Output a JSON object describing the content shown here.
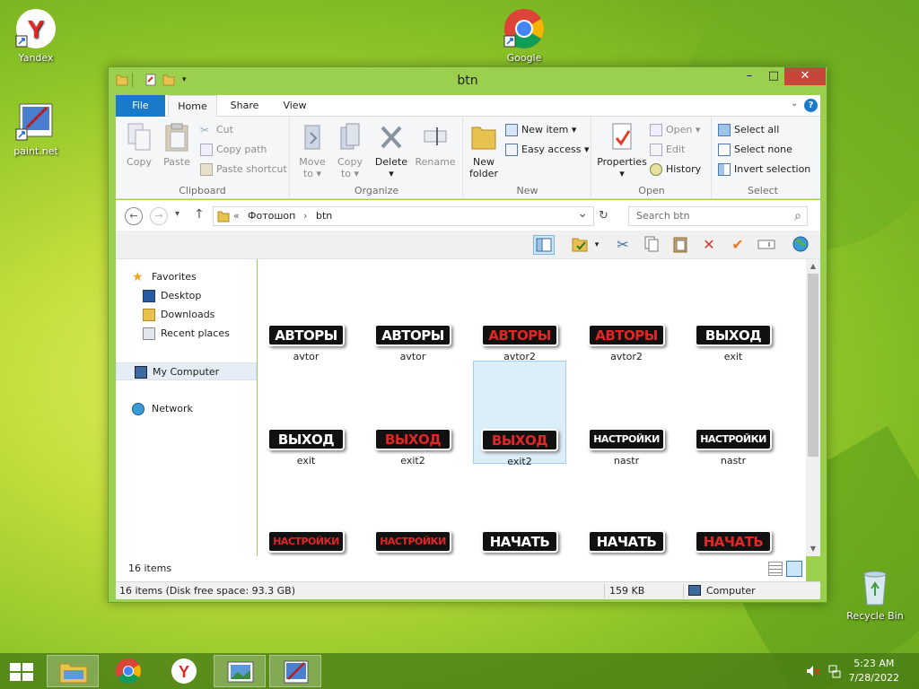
{
  "desktop": {
    "icons": [
      {
        "label": "Yandex"
      },
      {
        "label": "Google"
      },
      {
        "label": "paint.net"
      },
      {
        "label": "Recycle Bin"
      }
    ]
  },
  "window": {
    "title": "btn",
    "controls": {
      "minimize": "–",
      "maximize": "□",
      "close": "✕"
    }
  },
  "ribbon": {
    "tabs": [
      "File",
      "Home",
      "Share",
      "View"
    ],
    "clipboard": {
      "label": "Clipboard",
      "copy": "Copy",
      "paste": "Paste",
      "cut": "Cut",
      "copy_path": "Copy path",
      "paste_shortcut": "Paste shortcut"
    },
    "organize": {
      "label": "Organize",
      "move_to": "Move",
      "move_to2": "to ▾",
      "copy_to": "Copy",
      "copy_to2": "to ▾",
      "delete": "Delete",
      "delete2": "▾",
      "rename": "Rename"
    },
    "new": {
      "label": "New",
      "new_folder": "New",
      "new_folder2": "folder",
      "new_item": "New item ▾",
      "easy_access": "Easy access ▾"
    },
    "open": {
      "label": "Open",
      "properties": "Properties",
      "properties2": "▾",
      "open": "Open ▾",
      "edit": "Edit",
      "history": "History"
    },
    "select": {
      "label": "Select",
      "select_all": "Select all",
      "select_none": "Select none",
      "invert": "Invert selection"
    }
  },
  "navbar": {
    "back": "←",
    "forward": "→",
    "recent": "▾",
    "up": "↑",
    "breadcrumb_prefix": "«",
    "path": [
      "Фотошоп",
      "btn"
    ],
    "sep": "›",
    "dropdown": "⌄",
    "refresh": "↻",
    "search_placeholder": "Search btn",
    "search_icon": "⌕"
  },
  "navpane": {
    "favorites": "Favorites",
    "desktop": "Desktop",
    "downloads": "Downloads",
    "recent": "Recent places",
    "computer": "My Computer",
    "network": "Network"
  },
  "files": [
    {
      "name": "avtor",
      "text": "АВТОРЫ",
      "color": "white"
    },
    {
      "name": "avtor",
      "text": "АВТОРЫ",
      "color": "white"
    },
    {
      "name": "avtor2",
      "text": "АВТОРЫ",
      "color": "red"
    },
    {
      "name": "avtor2",
      "text": "АВТОРЫ",
      "color": "red"
    },
    {
      "name": "exit",
      "text": "ВЫХОД",
      "color": "white"
    },
    {
      "name": "exit",
      "text": "ВЫХОД",
      "color": "white"
    },
    {
      "name": "exit2",
      "text": "ВЫХОД",
      "color": "red"
    },
    {
      "name": "exit2",
      "text": "ВЫХОД",
      "color": "red",
      "selected": true
    },
    {
      "name": "nastr",
      "text": "НАСТРОЙКИ",
      "color": "white"
    },
    {
      "name": "nastr",
      "text": "НАСТРОЙКИ",
      "color": "white"
    },
    {
      "name": "",
      "text": "НАСТРОЙКИ",
      "color": "red"
    },
    {
      "name": "",
      "text": "НАСТРОЙКИ",
      "color": "red"
    },
    {
      "name": "",
      "text": "НАЧАТЬ",
      "color": "white"
    },
    {
      "name": "",
      "text": "НАЧАТЬ",
      "color": "white"
    },
    {
      "name": "",
      "text": "НАЧАТЬ",
      "color": "red"
    }
  ],
  "item_count": "16 items",
  "status": {
    "left": "16 items (Disk free space: 93.3 GB)",
    "size": "159 KB",
    "location": "Computer"
  },
  "taskbar": {
    "time": "5:23 AM",
    "date": "7/28/2022"
  },
  "colors": {
    "accent": "#1979ca",
    "window_frame": "#9bd04f",
    "close": "#c7463a"
  }
}
